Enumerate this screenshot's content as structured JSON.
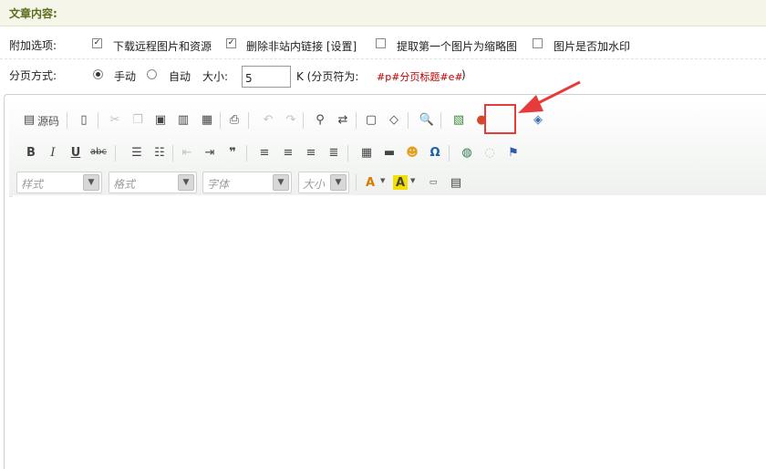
{
  "header": {
    "title": "文章内容:"
  },
  "options": {
    "label": "附加选项:",
    "items": [
      {
        "label": "下载远程图片和资源",
        "checked": true
      },
      {
        "label": "删除非站内链接 [设置]",
        "checked": true
      },
      {
        "label": "提取第一个图片为缩略图",
        "checked": false
      },
      {
        "label": "图片是否加水印",
        "checked": false
      }
    ]
  },
  "paging": {
    "label": "分页方式:",
    "manual_label": "手动",
    "auto_label": "自动",
    "selected": "手动",
    "size_label": "大小:",
    "size_value": "5",
    "unit_label": "K (分页符为:",
    "separator_token": "#p#分页标题#e#",
    "close_paren": ")"
  },
  "toolbar": {
    "source_label": "源码",
    "combos": {
      "style": "样式",
      "format": "格式",
      "font": "字体",
      "size": "大小"
    },
    "highlight_color": "#e53b3b",
    "arrow_color": "#e53b3b"
  }
}
